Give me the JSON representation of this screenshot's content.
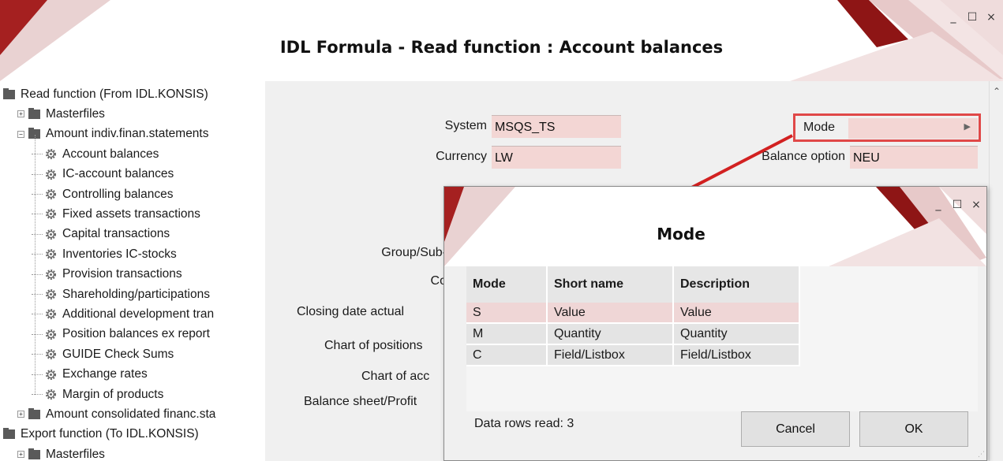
{
  "window": {
    "title": "IDL Formula - Read function : Account balances",
    "controls": {
      "minimize": "_",
      "maximize": "☐",
      "close": "×"
    },
    "accent_color": "#9b1b1b"
  },
  "tree": {
    "items": [
      {
        "label": "Read function (From IDL.KONSIS)",
        "icon": "folder-icon",
        "level": 0
      },
      {
        "label": "Masterfiles",
        "icon": "folder-icon",
        "level": 1,
        "expander": "+"
      },
      {
        "label": "Amount indiv.finan.statements",
        "icon": "folder-icon",
        "level": 1,
        "expander": "−"
      },
      {
        "label": "Account balances",
        "icon": "gear-icon",
        "level": 2
      },
      {
        "label": "IC-account balances",
        "icon": "gear-icon",
        "level": 2
      },
      {
        "label": "Controlling balances",
        "icon": "gear-icon",
        "level": 2
      },
      {
        "label": "Fixed assets transactions",
        "icon": "gear-icon",
        "level": 2
      },
      {
        "label": "Capital transactions",
        "icon": "gear-icon",
        "level": 2
      },
      {
        "label": "Inventories IC-stocks",
        "icon": "gear-icon",
        "level": 2
      },
      {
        "label": "Provision transactions",
        "icon": "gear-icon",
        "level": 2
      },
      {
        "label": "Shareholding/participations",
        "icon": "gear-icon",
        "level": 2
      },
      {
        "label": "Additional development tran",
        "icon": "gear-icon",
        "level": 2
      },
      {
        "label": "Position balances ex report",
        "icon": "gear-icon",
        "level": 2
      },
      {
        "label": "GUIDE Check Sums",
        "icon": "gear-icon",
        "level": 2
      },
      {
        "label": "Exchange rates",
        "icon": "gear-icon",
        "level": 2
      },
      {
        "label": "Margin of products",
        "icon": "gear-icon",
        "level": 2
      },
      {
        "label": "Amount consolidated financ.sta",
        "icon": "folder-icon",
        "level": 1,
        "expander": "+"
      },
      {
        "label": "Export function (To IDL.KONSIS)",
        "icon": "folder-icon",
        "level": 0
      },
      {
        "label": "Masterfiles",
        "icon": "folder-icon",
        "level": 1,
        "expander": "+"
      }
    ]
  },
  "form": {
    "system_label": "System",
    "system_value": "MSQS_TS",
    "currency_label": "Currency",
    "currency_value": "LW",
    "mode_label": "Mode",
    "mode_value": "",
    "balance_option_label": "Balance option",
    "balance_option_value": "NEU",
    "group_label": "Group/Sub-",
    "co_label": "Co",
    "closing_date_label": "Closing date actual",
    "chart_positions_label": "Chart of positions",
    "chart_acc_label": "Chart of acc",
    "balance_sheet_label": "Balance sheet/Profit"
  },
  "dialog": {
    "title": "Mode",
    "columns": [
      "Mode",
      "Short name",
      "Description"
    ],
    "rows": [
      [
        "S",
        "Value",
        "Value"
      ],
      [
        "M",
        "Quantity",
        "Quantity"
      ],
      [
        "C",
        "Field/Listbox",
        "Field/Listbox"
      ]
    ],
    "selected_row": 0,
    "rows_read": "Data rows read: 3",
    "cancel_label": "Cancel",
    "ok_label": "OK"
  }
}
